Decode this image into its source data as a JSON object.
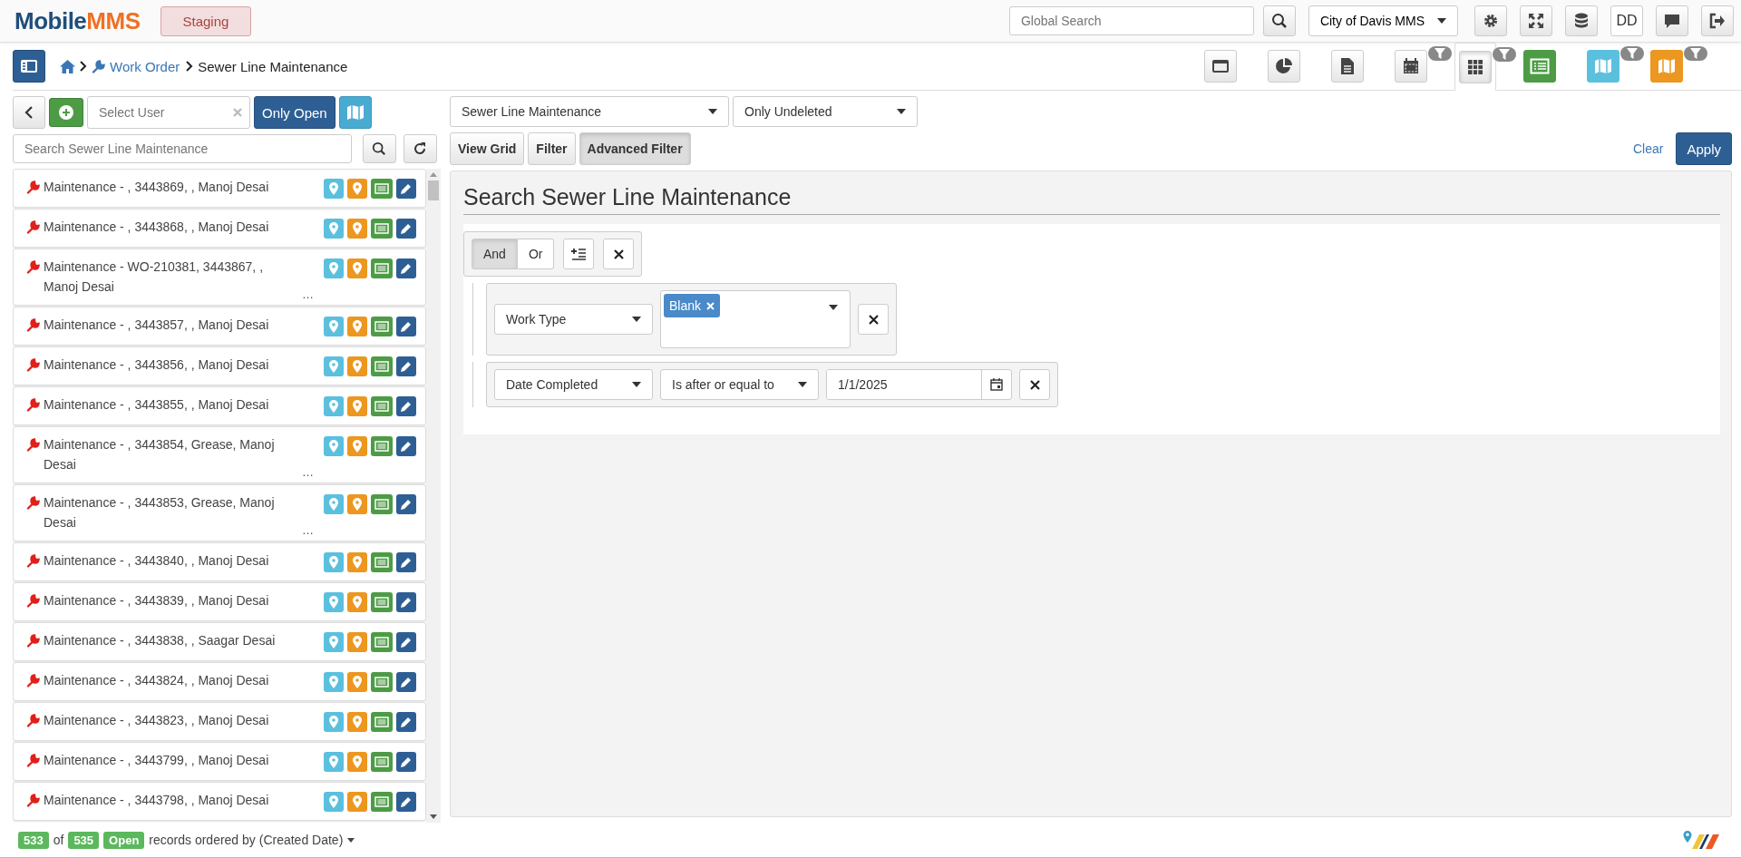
{
  "header": {
    "logo_first": "Mobile",
    "logo_second": "MMS",
    "environment": "Staging",
    "search": {
      "placeholder": "Global Search"
    },
    "organization": "City of Davis MMS",
    "actions": [
      {
        "kind": "gear"
      },
      {
        "kind": "expand"
      },
      {
        "kind": "database"
      },
      {
        "kind": "user",
        "label": "DD"
      },
      {
        "kind": "chat"
      },
      {
        "kind": "logout"
      }
    ]
  },
  "breadcrumb": {
    "link": "Work Order",
    "current": "Sewer Line Maintenance"
  },
  "views": [
    {
      "kind": "window",
      "filter": false,
      "selected": false
    },
    {
      "kind": "pie",
      "filter": false,
      "selected": false
    },
    {
      "kind": "document",
      "filter": false,
      "selected": false
    },
    {
      "kind": "calendar",
      "filter": true,
      "selected": false
    },
    {
      "kind": "grid",
      "filter": true,
      "selected": true
    },
    {
      "kind": "list",
      "color": "#4d9c45",
      "filter": false,
      "selected": false
    },
    {
      "kind": "map",
      "color": "#5bc0de",
      "filter": true,
      "selected": false
    },
    {
      "kind": "map",
      "color": "#ec971f",
      "filter": true,
      "selected": false
    }
  ],
  "left": {
    "user_select": {
      "placeholder": "Select User"
    },
    "only_open": {
      "label": "Only Open",
      "on": true
    },
    "search": {
      "placeholder": "Search Sewer Line Maintenance"
    },
    "rows": [
      {
        "title": "Maintenance - , 3443869, , Manoj Desai"
      },
      {
        "title": "Maintenance - , 3443868, , Manoj Desai"
      },
      {
        "title": "Maintenance - WO-210381, 3443867, , Manoj Desai",
        "more": "…"
      },
      {
        "title": "Maintenance - , 3443857, , Manoj Desai"
      },
      {
        "title": "Maintenance - , 3443856, , Manoj Desai"
      },
      {
        "title": "Maintenance - , 3443855, , Manoj Desai"
      },
      {
        "title": "Maintenance - , 3443854, Grease, Manoj Desai",
        "more": "…"
      },
      {
        "title": "Maintenance - , 3443853, Grease, Manoj Desai",
        "more": "…"
      },
      {
        "title": "Maintenance - , 3443840, , Manoj Desai"
      },
      {
        "title": "Maintenance - , 3443839, , Manoj Desai"
      },
      {
        "title": "Maintenance - , 3443838, , Saagar Desai"
      },
      {
        "title": "Maintenance - , 3443824, , Manoj Desai"
      },
      {
        "title": "Maintenance - , 3443823, , Manoj Desai"
      },
      {
        "title": "Maintenance - , 3443799, , Manoj Desai"
      },
      {
        "title": "Maintenance - , 3443798, , Manoj Desai"
      }
    ]
  },
  "right": {
    "type_select": "Sewer Line Maintenance",
    "deleted_select": "Only Undeleted",
    "tabs": [
      {
        "label": "View Grid",
        "selected": false
      },
      {
        "label": "Filter",
        "selected": false
      },
      {
        "label": "Advanced Filter",
        "selected": true
      }
    ],
    "clear": "Clear",
    "apply": "Apply",
    "panel_title": "Search Sewer Line Maintenance",
    "conjunctions": [
      {
        "label": "And",
        "selected": true
      },
      {
        "label": "Or",
        "selected": false
      }
    ],
    "rules": [
      {
        "kind": "multi",
        "field": "Work Type",
        "tags": [
          "Blank"
        ]
      },
      {
        "kind": "date",
        "field": "Date Completed",
        "operator": "Is after or equal to",
        "value": "1/1/2025"
      }
    ]
  },
  "footer": {
    "shown": "533",
    "of": "of",
    "total": "535",
    "status": "Open",
    "text": "records ordered by (Created Date)"
  }
}
